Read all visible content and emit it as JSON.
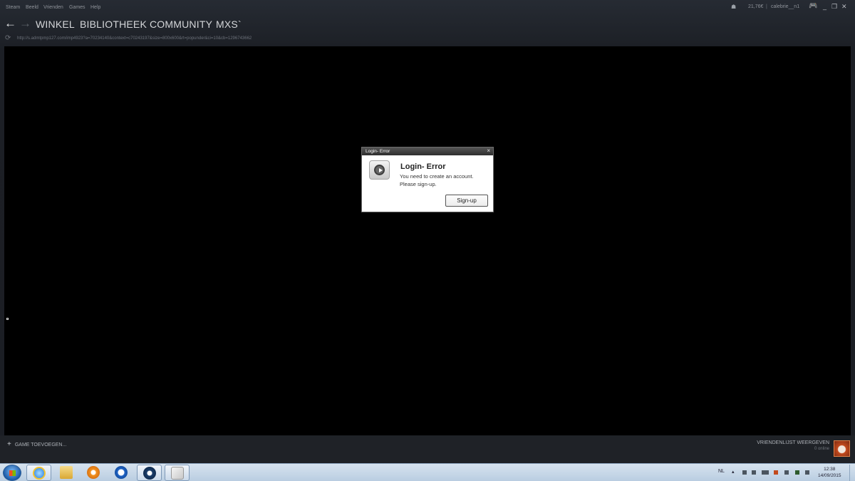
{
  "menubar": {
    "items": [
      "Steam",
      "Beeld",
      "Vrienden",
      "Games",
      "Help"
    ],
    "balance": "21,76€",
    "username": "calebrie__n1"
  },
  "nav": {
    "back": "←",
    "forward": "→",
    "tabs": [
      "WINKEL",
      "BIBLIOTHEEK",
      "COMMUNITY",
      "MXS`"
    ]
  },
  "url": "http://s.admtpmp127.com/imp4923?a=70234140&context=c70243197&size=800x600&rt=popunder&ci=10&cb=1296743662",
  "dialog": {
    "title": "Login- Error",
    "close": "×",
    "heading": "Login- Error",
    "message_line1": "You need to create an account.",
    "message_line2": "Please sign-up.",
    "button": "Sign-up"
  },
  "bottom": {
    "add_game": "GAME TOEVOEGEN...",
    "friends_label": "VRIENDENLIJST WEERGEVEN",
    "online": "0 online"
  },
  "taskbar": {
    "language": "NL",
    "time": "12:38",
    "date": "14/09/2015"
  }
}
